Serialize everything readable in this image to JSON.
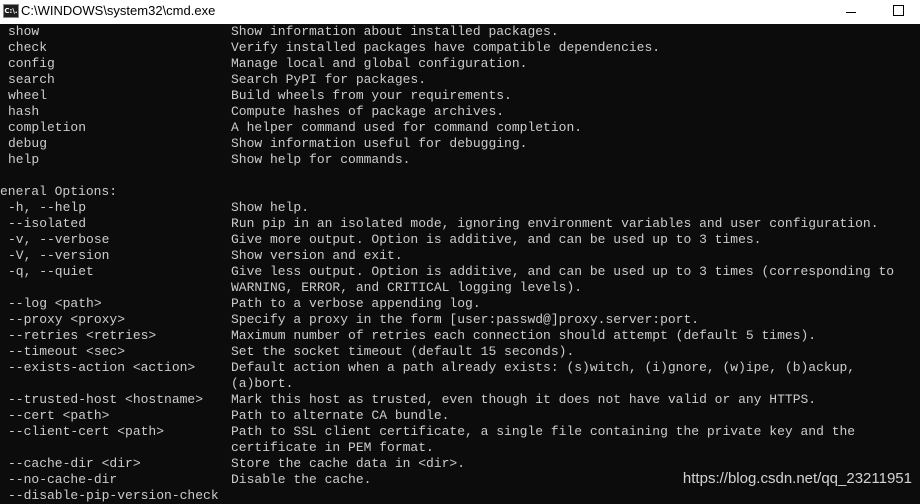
{
  "window": {
    "title": "C:\\WINDOWS\\system32\\cmd.exe",
    "icon": "cmd-icon",
    "icon_text": "C:\\."
  },
  "commands": [
    {
      "cmd": "show",
      "desc": "Show information about installed packages."
    },
    {
      "cmd": "check",
      "desc": "Verify installed packages have compatible dependencies."
    },
    {
      "cmd": "config",
      "desc": "Manage local and global configuration."
    },
    {
      "cmd": "search",
      "desc": "Search PyPI for packages."
    },
    {
      "cmd": "wheel",
      "desc": "Build wheels from your requirements."
    },
    {
      "cmd": "hash",
      "desc": "Compute hashes of package archives."
    },
    {
      "cmd": "completion",
      "desc": "A helper command used for command completion."
    },
    {
      "cmd": "debug",
      "desc": "Show information useful for debugging."
    },
    {
      "cmd": "help",
      "desc": "Show help for commands."
    }
  ],
  "options_header": "eneral Options:",
  "options": [
    {
      "cmd": "-h, --help",
      "desc": "Show help."
    },
    {
      "cmd": "--isolated",
      "desc": "Run pip in an isolated mode, ignoring environment variables and user configuration."
    },
    {
      "cmd": "-v, --verbose",
      "desc": "Give more output. Option is additive, and can be used up to 3 times."
    },
    {
      "cmd": "-V, --version",
      "desc": "Show version and exit."
    },
    {
      "cmd": "-q, --quiet",
      "desc": "Give less output. Option is additive, and can be used up to 3 times (corresponding to"
    },
    {
      "cmd": "",
      "desc": "WARNING, ERROR, and CRITICAL logging levels)."
    },
    {
      "cmd": "--log <path>",
      "desc": "Path to a verbose appending log."
    },
    {
      "cmd": "--proxy <proxy>",
      "desc": "Specify a proxy in the form [user:passwd@]proxy.server:port."
    },
    {
      "cmd": "--retries <retries>",
      "desc": "Maximum number of retries each connection should attempt (default 5 times)."
    },
    {
      "cmd": "--timeout <sec>",
      "desc": "Set the socket timeout (default 15 seconds)."
    },
    {
      "cmd": "--exists-action <action>",
      "desc": "Default action when a path already exists: (s)witch, (i)gnore, (w)ipe, (b)ackup,"
    },
    {
      "cmd": "",
      "desc": "(a)bort."
    },
    {
      "cmd": "--trusted-host <hostname>",
      "desc": "Mark this host as trusted, even though it does not have valid or any HTTPS."
    },
    {
      "cmd": "--cert <path>",
      "desc": "Path to alternate CA bundle."
    },
    {
      "cmd": "--client-cert <path>",
      "desc": "Path to SSL client certificate, a single file containing the private key and the"
    },
    {
      "cmd": "",
      "desc": "certificate in PEM format."
    },
    {
      "cmd": "--cache-dir <dir>",
      "desc": "Store the cache data in <dir>."
    },
    {
      "cmd": "--no-cache-dir",
      "desc": "Disable the cache."
    },
    {
      "cmd": "--disable-pip-version-check",
      "desc": ""
    }
  ],
  "watermark": "https://blog.csdn.net/qq_23211951"
}
